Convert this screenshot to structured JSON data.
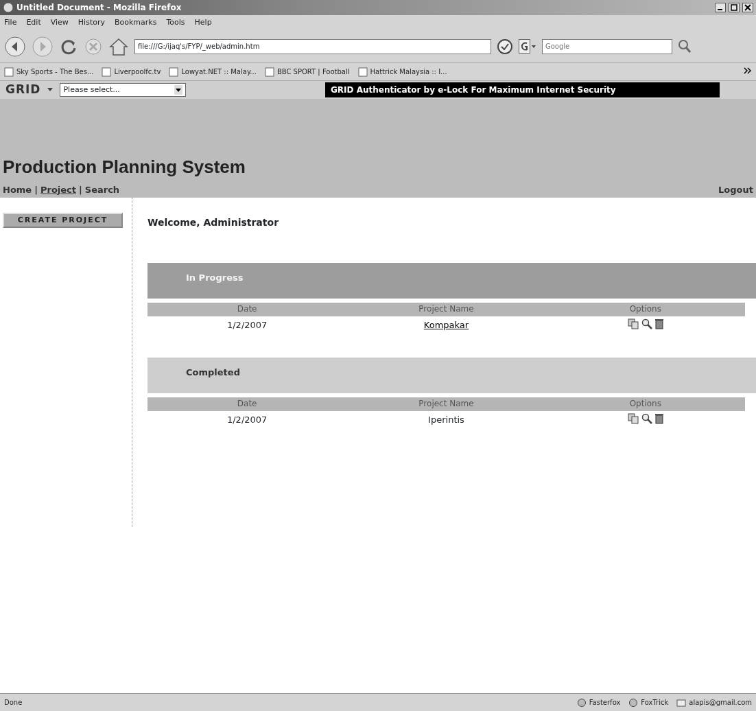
{
  "window": {
    "title": "Untitled Document - Mozilla Firefox"
  },
  "menu": [
    "File",
    "Edit",
    "View",
    "History",
    "Bookmarks",
    "Tools",
    "Help"
  ],
  "address": {
    "value": "file:///G:/ijaq's/FYP/_web/admin.htm"
  },
  "search": {
    "placeholder": "Google"
  },
  "bookmarks": [
    "Sky Sports - The Bes...",
    "Liverpoolfc.tv",
    "Lowyat.NET :: Malay...",
    "BBC SPORT | Football",
    "Hattrick Malaysia :: I..."
  ],
  "grid_toolbar": {
    "logo": "GRID",
    "select": "Please select...",
    "banner": "GRID Authenticator by e-Lock For Maximum Internet Security"
  },
  "page": {
    "title": "Production Planning System",
    "nav": [
      {
        "label": "Home",
        "selected": false
      },
      {
        "label": "Project",
        "selected": true
      },
      {
        "label": "Search",
        "selected": false
      }
    ],
    "nav_separator": "|",
    "logout": "Logout",
    "create_button": "CREATE PROJECT",
    "welcome": "Welcome, Administrator",
    "sections": [
      {
        "title": "In Progress",
        "columns": [
          "Date",
          "Project Name",
          "Options"
        ],
        "rows": [
          {
            "date": "1/2/2007",
            "name": "Kompakar",
            "link": true
          }
        ]
      },
      {
        "title": "Completed",
        "columns": [
          "Date",
          "Project Name",
          "Options"
        ],
        "rows": [
          {
            "date": "1/2/2007",
            "name": "Iperintis",
            "link": false
          }
        ]
      }
    ]
  },
  "status_bar": {
    "text": "Done",
    "items": [
      "Fasterfox",
      "FoxTrick",
      "alapis@gmail.com"
    ]
  }
}
